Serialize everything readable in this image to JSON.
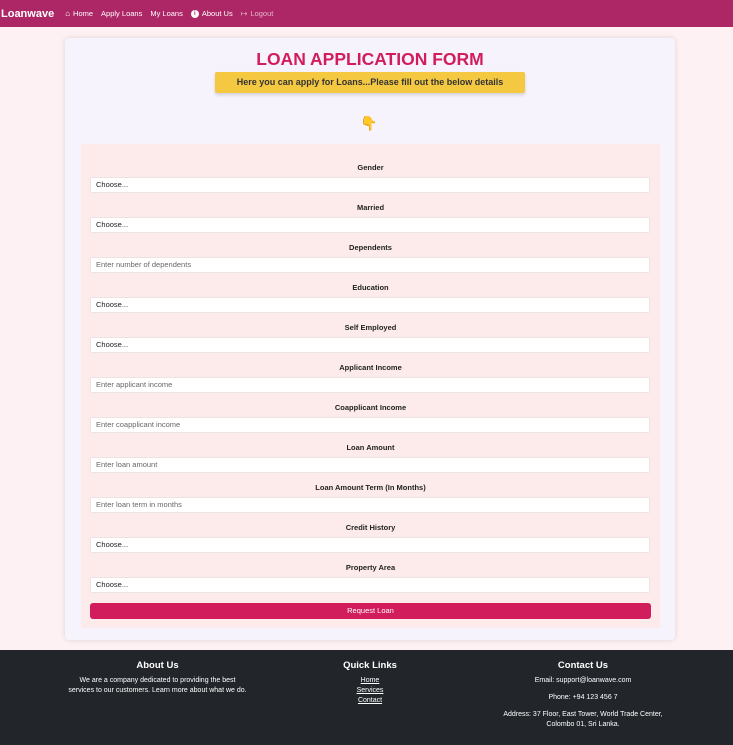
{
  "navbar": {
    "brand": "Loanwave",
    "items": [
      {
        "label": "Home",
        "icon": "home-icon"
      },
      {
        "label": "Apply Loans"
      },
      {
        "label": "My Loans"
      },
      {
        "label": "About Us",
        "icon": "info-icon"
      },
      {
        "label": "Logout",
        "icon": "logout-icon"
      }
    ]
  },
  "form": {
    "title": "LOAN APPLICATION FORM",
    "subtitle": "Here you can apply for Loans...Please fill out the below details",
    "pointer_icon": "pointing-down-hand-icon",
    "fields": [
      {
        "label": "Gender",
        "value": "Choose..."
      },
      {
        "label": "Married",
        "value": "Choose..."
      },
      {
        "label": "Dependents",
        "placeholder": "Enter number of dependents"
      },
      {
        "label": "Education",
        "value": "Choose..."
      },
      {
        "label": "Self Employed",
        "value": "Choose..."
      },
      {
        "label": "Applicant Income",
        "placeholder": "Enter applicant income"
      },
      {
        "label": "Coapplicant Income",
        "placeholder": "Enter coapplicant income"
      },
      {
        "label": "Loan Amount",
        "placeholder": "Enter loan amount"
      },
      {
        "label": "Loan Amount Term (In Months)",
        "placeholder": "Enter loan term in months"
      },
      {
        "label": "Credit History",
        "value": "Choose..."
      },
      {
        "label": "Property Area",
        "value": "Choose..."
      }
    ],
    "submit_label": "Request Loan"
  },
  "footer": {
    "about": {
      "heading": "About Us",
      "text_line1": "We are a company dedicated to providing the best",
      "text_line2": "services to our customers. Learn more about what we do."
    },
    "quick_links": {
      "heading": "Quick Links",
      "links": [
        "Home",
        "Services",
        "Contact"
      ]
    },
    "contact": {
      "heading": "Contact Us",
      "email": "Email: support@loanwave.com",
      "phone": "Phone: +94 123 456 7",
      "address_line1": "Address: 37 Floor, East Tower, World Trade Center,",
      "address_line2": "Colombo 01, Sri Lanka."
    }
  },
  "colors": {
    "nav": "#ad2666",
    "accent": "#d11d5b",
    "banner": "#f5c842",
    "footer": "#22262b"
  }
}
